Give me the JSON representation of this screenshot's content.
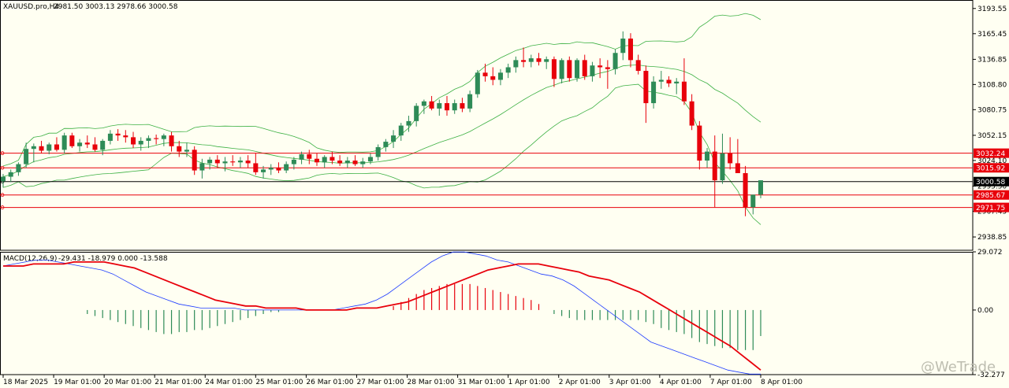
{
  "chart_data": [
    {
      "type": "candlestick",
      "instrument": "XAUUSD.pro,H4",
      "ohlc_header": "2981.50 3003.13 2978.66 3000.58",
      "y_ticks": [
        "3193.55",
        "3165.45",
        "3136.85",
        "3108.80",
        "3080.75",
        "3052.15",
        "3024.10",
        "2995.50",
        "2967.45",
        "2938.85"
      ],
      "ylim": [
        2924,
        3203
      ],
      "price_levels": [
        {
          "value": 3032.24,
          "label": "3032.24",
          "kind": "line"
        },
        {
          "value": 3015.92,
          "label": "3015.92",
          "kind": "line"
        },
        {
          "value": 3000.58,
          "label": "3000.58",
          "kind": "current"
        },
        {
          "value": 2985.67,
          "label": "2985.67",
          "kind": "line"
        },
        {
          "value": 2971.75,
          "label": "2971.75",
          "kind": "line"
        }
      ],
      "x_labels": [
        "18 Mar 2025",
        "19 Mar 01:00",
        "20 Mar 01:00",
        "21 Mar 01:00",
        "24 Mar 01:00",
        "25 Mar 01:00",
        "26 Mar 01:00",
        "27 Mar 01:00",
        "28 Mar 01:00",
        "31 Mar 01:00",
        "1 Apr 01:00",
        "2 Apr 01:00",
        "3 Apr 01:00",
        "4 Apr 01:00",
        "7 Apr 01:00",
        "8 Apr 01:00"
      ],
      "candles": [
        [
          3001,
          3009,
          2994,
          3006
        ],
        [
          3006,
          3014,
          3000,
          3011
        ],
        [
          3011,
          3022,
          3007,
          3020
        ],
        [
          3020,
          3044,
          3016,
          3037
        ],
        [
          3037,
          3043,
          3022,
          3040
        ],
        [
          3040,
          3046,
          3032,
          3035
        ],
        [
          3035,
          3044,
          3031,
          3042
        ],
        [
          3042,
          3050,
          3034,
          3036
        ],
        [
          3036,
          3055,
          3032,
          3052
        ],
        [
          3052,
          3055,
          3038,
          3040
        ],
        [
          3040,
          3048,
          3034,
          3044
        ],
        [
          3044,
          3052,
          3038,
          3042
        ],
        [
          3042,
          3050,
          3034,
          3036
        ],
        [
          3036,
          3048,
          3030,
          3046
        ],
        [
          3046,
          3058,
          3042,
          3054
        ],
        [
          3054,
          3059,
          3046,
          3052
        ],
        [
          3052,
          3058,
          3044,
          3050
        ],
        [
          3050,
          3056,
          3038,
          3042
        ],
        [
          3042,
          3050,
          3035,
          3046
        ],
        [
          3046,
          3052,
          3038,
          3049
        ],
        [
          3049,
          3053,
          3042,
          3048
        ],
        [
          3048,
          3054,
          3040,
          3052
        ],
        [
          3052,
          3056,
          3034,
          3040
        ],
        [
          3040,
          3046,
          3028,
          3034
        ],
        [
          3034,
          3044,
          3028,
          3036
        ],
        [
          3036,
          3040,
          3008,
          3013
        ],
        [
          3013,
          3026,
          3004,
          3021
        ],
        [
          3021,
          3028,
          3014,
          3025
        ],
        [
          3025,
          3030,
          3016,
          3021
        ],
        [
          3021,
          3028,
          3012,
          3023
        ],
        [
          3023,
          3030,
          3018,
          3022
        ],
        [
          3022,
          3028,
          3016,
          3024
        ],
        [
          3024,
          3030,
          3016,
          3021
        ],
        [
          3021,
          3032,
          3008,
          3011
        ],
        [
          3011,
          3018,
          3004,
          3014
        ],
        [
          3014,
          3020,
          3008,
          3016
        ],
        [
          3016,
          3022,
          3010,
          3013
        ],
        [
          3013,
          3023,
          3010,
          3020
        ],
        [
          3020,
          3028,
          3014,
          3025
        ],
        [
          3025,
          3034,
          3020,
          3031
        ],
        [
          3031,
          3036,
          3020,
          3026
        ],
        [
          3026,
          3032,
          3018,
          3022
        ],
        [
          3022,
          3030,
          3016,
          3028
        ],
        [
          3028,
          3034,
          3020,
          3024
        ],
        [
          3024,
          3030,
          3018,
          3021
        ],
        [
          3021,
          3028,
          3016,
          3024
        ],
        [
          3024,
          3030,
          3018,
          3020
        ],
        [
          3020,
          3027,
          3016,
          3023
        ],
        [
          3023,
          3032,
          3020,
          3028
        ],
        [
          3028,
          3042,
          3024,
          3039
        ],
        [
          3039,
          3048,
          3034,
          3045
        ],
        [
          3045,
          3058,
          3038,
          3052
        ],
        [
          3052,
          3066,
          3046,
          3063
        ],
        [
          3063,
          3074,
          3056,
          3068
        ],
        [
          3068,
          3088,
          3062,
          3085
        ],
        [
          3085,
          3092,
          3076,
          3090
        ],
        [
          3090,
          3096,
          3080,
          3082
        ],
        [
          3082,
          3092,
          3074,
          3088
        ],
        [
          3088,
          3096,
          3074,
          3080
        ],
        [
          3080,
          3092,
          3076,
          3088
        ],
        [
          3088,
          3094,
          3078,
          3082
        ],
        [
          3082,
          3102,
          3078,
          3098
        ],
        [
          3098,
          3125,
          3094,
          3122
        ],
        [
          3122,
          3132,
          3112,
          3118
        ],
        [
          3118,
          3128,
          3108,
          3114
        ],
        [
          3114,
          3126,
          3108,
          3122
        ],
        [
          3122,
          3132,
          3116,
          3128
        ],
        [
          3128,
          3140,
          3122,
          3136
        ],
        [
          3136,
          3150,
          3128,
          3134
        ],
        [
          3134,
          3142,
          3128,
          3138
        ],
        [
          3138,
          3144,
          3130,
          3134
        ],
        [
          3134,
          3140,
          3126,
          3137
        ],
        [
          3137,
          3140,
          3106,
          3115
        ],
        [
          3115,
          3138,
          3110,
          3136
        ],
        [
          3136,
          3140,
          3112,
          3116
        ],
        [
          3116,
          3138,
          3112,
          3136
        ],
        [
          3136,
          3142,
          3114,
          3118
        ],
        [
          3118,
          3134,
          3112,
          3130
        ],
        [
          3130,
          3138,
          3116,
          3128
        ],
        [
          3128,
          3136,
          3104,
          3126
        ],
        [
          3126,
          3148,
          3120,
          3144
        ],
        [
          3144,
          3168,
          3136,
          3160
        ],
        [
          3160,
          3166,
          3128,
          3136
        ],
        [
          3136,
          3142,
          3120,
          3124
        ],
        [
          3124,
          3130,
          3066,
          3088
        ],
        [
          3088,
          3118,
          3082,
          3112
        ],
        [
          3112,
          3124,
          3104,
          3114
        ],
        [
          3114,
          3118,
          3106,
          3110
        ],
        [
          3110,
          3116,
          3098,
          3112
        ],
        [
          3112,
          3138,
          3086,
          3090
        ],
        [
          3090,
          3098,
          3058,
          3063
        ],
        [
          3063,
          3068,
          3014,
          3024
        ],
        [
          3024,
          3038,
          3016,
          3034
        ],
        [
          3034,
          3052,
          2972,
          3002
        ],
        [
          3002,
          3054,
          2998,
          3032
        ],
        [
          3032,
          3050,
          3014,
          3021
        ],
        [
          3021,
          3048,
          3016,
          3010
        ],
        [
          3010,
          3018,
          2962,
          2972
        ],
        [
          2972,
          2982,
          2964,
          2986
        ],
        [
          2986,
          3002,
          2982,
          3002
        ]
      ],
      "bollinger": {
        "period": 20,
        "deviation": 2
      }
    },
    {
      "type": "bar-line",
      "indicator": "MACD(12,26,9)",
      "header_values": "-29.431 -18.979 0.000 -13.588",
      "y_ticks": [
        "29.072",
        "0.00",
        "-32.277"
      ],
      "ylim": [
        -32.277,
        29.072
      ],
      "histogram": [
        0,
        0,
        0,
        0,
        0,
        0,
        0,
        0,
        0,
        0,
        0,
        -2,
        -3,
        -4,
        -5,
        -6,
        -7,
        -8,
        -9,
        -10,
        -11,
        -12,
        -12,
        -11,
        -11,
        -10,
        -10,
        -9,
        -8,
        -7,
        -6,
        -5,
        -4,
        -3,
        -2,
        -1,
        -1,
        0,
        0,
        0,
        0,
        0,
        0,
        0,
        0,
        0,
        0,
        0,
        0,
        0,
        0,
        2,
        4,
        6,
        8,
        10,
        11,
        12,
        13,
        13,
        13,
        13,
        12,
        11,
        10,
        9,
        8,
        7,
        6,
        5,
        3,
        0,
        -2,
        -3,
        -4,
        -5,
        -5,
        -5,
        -5,
        -5,
        -5,
        -5,
        -5,
        -5,
        -6,
        -7,
        -9,
        -10,
        -11,
        -12,
        -14,
        -16,
        -17,
        -18,
        -19,
        -19,
        -20,
        -20,
        -20,
        -13
      ],
      "signal": [
        22,
        22,
        22,
        23,
        23,
        23,
        23,
        24,
        24,
        24,
        24,
        23,
        22,
        21,
        19,
        17,
        15,
        13,
        11,
        9,
        7,
        5,
        4,
        3,
        2,
        2,
        1,
        1,
        1,
        1,
        0,
        0,
        0,
        0,
        0,
        1,
        1,
        1,
        2,
        3,
        4,
        6,
        8,
        10,
        12,
        14,
        16,
        18,
        20,
        21,
        22,
        23,
        23,
        23,
        22,
        21,
        20,
        19,
        17,
        16,
        15,
        13,
        11,
        9,
        6,
        3,
        0,
        -3,
        -6,
        -9,
        -12,
        -15,
        -18,
        -22,
        -26,
        -30
      ],
      "macd": [
        22,
        23,
        24,
        25,
        25,
        24,
        23,
        22,
        21,
        20,
        18,
        15,
        12,
        9,
        7,
        5,
        3,
        2,
        1,
        1,
        1,
        1,
        0,
        0,
        0,
        0,
        0,
        0,
        0,
        0,
        0,
        1,
        2,
        3,
        5,
        8,
        12,
        16,
        20,
        24,
        27,
        29,
        29,
        28,
        27,
        25,
        24,
        22,
        20,
        18,
        17,
        15,
        12,
        8,
        4,
        0,
        -4,
        -8,
        -12,
        -16,
        -18,
        -20,
        -22,
        -24,
        -26,
        -28,
        -30,
        -31,
        -32,
        -32
      ]
    }
  ],
  "watermark": "@WeTrade",
  "colors": {
    "bull": "#2E8B57",
    "bear": "#E8000B",
    "band": "#3CB043",
    "signal": "#E8000B",
    "macd": "#1E3CFF",
    "level": "#E8000B",
    "background": "#FFFFF2"
  }
}
